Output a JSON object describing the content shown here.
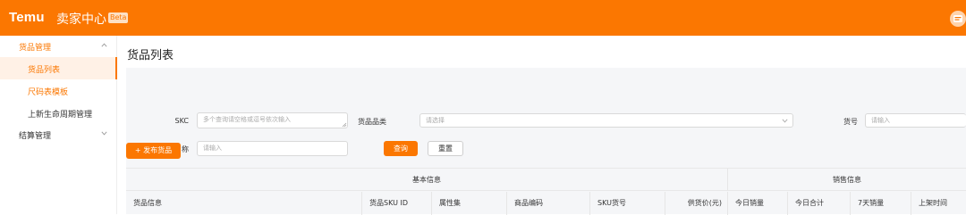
{
  "header": {
    "logo": "Temu",
    "title": "卖家中心",
    "badge": "Beta",
    "brand_color": "#fb7701"
  },
  "sidebar": {
    "groups": [
      {
        "label": "货品管理",
        "expanded": true,
        "icon": "chevron-up-icon",
        "items": [
          {
            "label": "货品列表",
            "active": true
          },
          {
            "label": "尺码表模板",
            "active": false
          },
          {
            "label": "上新生命周期管理",
            "active": false
          }
        ]
      },
      {
        "label": "结算管理",
        "expanded": false,
        "icon": "chevron-down-icon",
        "items": []
      }
    ]
  },
  "page": {
    "title": "货品列表"
  },
  "filters": {
    "skc_label": "SKC",
    "skc_placeholder": "多个查询请空格或逗号依次输入",
    "category_label": "货品品类",
    "category_placeholder": "请选择",
    "item_no_label": "货号",
    "item_no_placeholder": "请输入",
    "name_label": "货品名称",
    "name_placeholder": "请输入",
    "search_button": "查询",
    "reset_button": "重置"
  },
  "actions": {
    "publish_button": "+ 发布货品"
  },
  "table": {
    "group_headers": [
      "基本信息",
      "销售信息"
    ],
    "columns": [
      "货品信息",
      "货品SKU ID",
      "属性集",
      "商品编码",
      "SKU货号",
      "供货价(元)",
      "今日销量",
      "今日合计",
      "7天销量",
      "上架时间"
    ]
  }
}
